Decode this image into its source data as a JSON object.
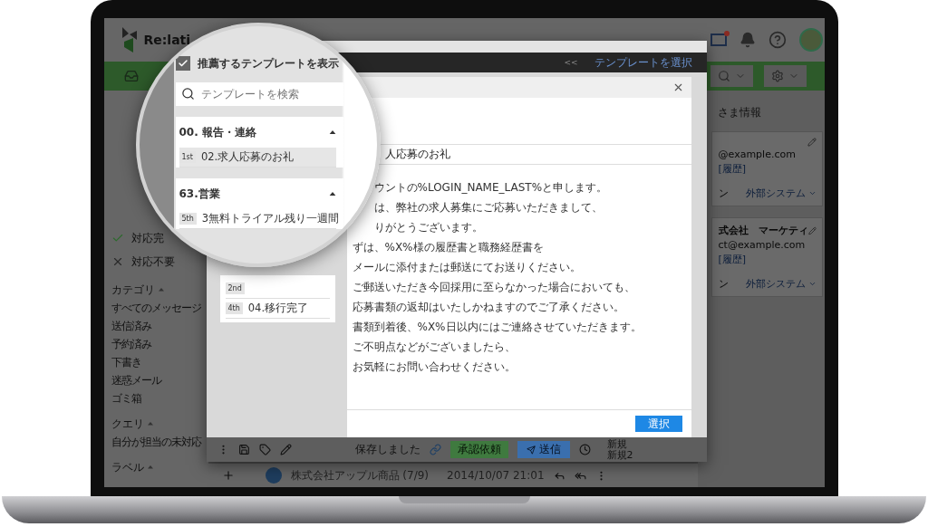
{
  "app": {
    "logo": "Re:lati",
    "sidebar": {
      "status_items": [
        {
          "kind": "check",
          "label": "対応完"
        },
        {
          "kind": "cross",
          "label": "対応不要"
        }
      ],
      "sections": [
        {
          "title": "カテゴリ",
          "expanded": true,
          "items": [
            "すべてのメッセージ",
            "送信済み",
            "予約済み",
            "下書き",
            "迷惑メール",
            "ゴミ箱"
          ]
        },
        {
          "title": "クエリ",
          "expanded": true,
          "items": [
            "自分が担当の未対応"
          ]
        },
        {
          "title": "ラベル",
          "expanded": true
        }
      ]
    },
    "customer_panel": {
      "title": "さま情報",
      "cards": [
        {
          "email": "@example.com",
          "history": "[履歴]",
          "status": "ン",
          "system": "外部システム"
        },
        {
          "name": "式会社　マーケティ",
          "email": "ct@example.com",
          "history": "[履歴]",
          "status": "ン",
          "system": "外部システム"
        }
      ]
    },
    "message_row": {
      "sender": "株式会社アップル商品 (7/9)",
      "date": "2014/10/07 21:01"
    }
  },
  "template_dialog": {
    "collapse": "<<",
    "link": "テンプレートを選択",
    "show_recommended": {
      "label": "推薦するテンプレートを表示",
      "checked": true
    },
    "search": {
      "placeholder": "テンプレートを検索"
    },
    "groups": [
      {
        "title": "00. 報告・連絡",
        "expanded": true,
        "items": [
          {
            "rank": "1st",
            "title": "02.求人応募のお礼",
            "selected": true
          }
        ]
      },
      {
        "title": "63.営業",
        "expanded": true,
        "items": [
          {
            "rank": "5th",
            "title": "3無料トライアル残り一週間",
            "selected": false
          }
        ]
      }
    ],
    "more_items": [
      {
        "rank": "2nd",
        "selected": false
      },
      {
        "rank": "4th",
        "title": "04.移行完了",
        "selected": false
      }
    ],
    "preview": {
      "subject": "人応募のお礼",
      "paragraphs": [
        [
          "ウントの%LOGIN_NAME_LAST%と申します。",
          "は、弊社の求人募集にご応募いただきまして、",
          "りがとうございます。"
        ],
        [
          "ずは、%X%様の履歴書と職務経歴書を",
          "メールに添付または郵送にてお送りください。"
        ],
        [
          "ご郵送いただき今回採用に至らなかった場合においても、",
          "応募書類の返却はいたしかねますのでご了承ください。"
        ],
        [
          "書類到着後、%X%日以内にはご連絡させていただきます。"
        ],
        [
          "ご不明点などがございましたら、",
          "お気軽にお問い合わせください。"
        ]
      ],
      "button": "選択"
    },
    "toolbar": {
      "status": "保存しました",
      "approve_button": "承認依頼",
      "send_button": "送信"
    },
    "side_labels": [
      "新規",
      "新規2"
    ]
  }
}
